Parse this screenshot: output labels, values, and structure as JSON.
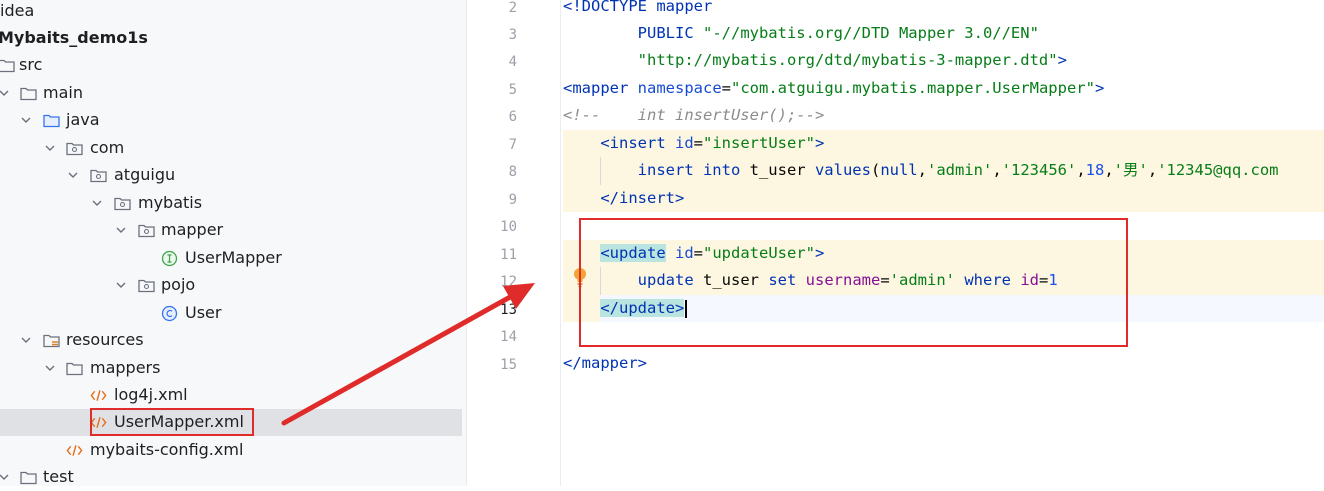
{
  "project_tree": {
    "items": [
      {
        "label": "idea",
        "icon": "folder-icon",
        "expanded": false
      },
      {
        "label": "Mybaits_demo1s",
        "icon": "module-icon",
        "expanded": true
      },
      {
        "label": "src",
        "icon": "folder-icon",
        "expanded": true
      },
      {
        "label": "main",
        "icon": "folder-icon",
        "expanded": true
      },
      {
        "label": "java",
        "icon": "source-folder-icon",
        "expanded": true
      },
      {
        "label": "com",
        "icon": "package-icon",
        "expanded": true
      },
      {
        "label": "atguigu",
        "icon": "package-icon",
        "expanded": true
      },
      {
        "label": "mybatis",
        "icon": "package-icon",
        "expanded": true
      },
      {
        "label": "mapper",
        "icon": "package-icon",
        "expanded": true
      },
      {
        "label": "UserMapper",
        "icon": "interface-icon"
      },
      {
        "label": "pojo",
        "icon": "package-icon",
        "expanded": true
      },
      {
        "label": "User",
        "icon": "class-icon"
      },
      {
        "label": "resources",
        "icon": "resources-folder-icon",
        "expanded": true
      },
      {
        "label": "mappers",
        "icon": "folder-icon",
        "expanded": true
      },
      {
        "label": "log4j.xml",
        "icon": "xml-file-icon"
      },
      {
        "label": "UserMapper.xml",
        "icon": "xml-file-icon",
        "selected": true
      },
      {
        "label": "mybaits-config.xml",
        "icon": "xml-file-icon"
      },
      {
        "label": "test",
        "icon": "folder-icon",
        "expanded": true
      }
    ]
  },
  "editor": {
    "line_numbers": [
      "2",
      "3",
      "4",
      "5",
      "6",
      "7",
      "8",
      "9",
      "10",
      "11",
      "12",
      "13",
      "14",
      "15"
    ],
    "current_line": "13",
    "lines": {
      "l2": {
        "open": "<!DOCTYPE",
        "name": " mapper"
      },
      "l3": {
        "indent": "        ",
        "kw": "PUBLIC",
        "val": " \"-//mybatis.org//DTD Mapper 3.0//EN\""
      },
      "l4": {
        "indent": "        ",
        "val": "\"http://mybatis.org/dtd/mybatis-3-mapper.dtd\"",
        "close": ">"
      },
      "l5": {
        "open": "<mapper",
        "attr": " namespace",
        "eq": "=",
        "val": "\"com.atguigu.mybatis.mapper.UserMapper\"",
        "close": ">"
      },
      "l6": {
        "comment": "<!--    int insertUser();-->"
      },
      "l7": {
        "indent": "    ",
        "open": "<insert",
        "attr": " id",
        "eq": "=",
        "val": "\"insertUser\"",
        "close": ">"
      },
      "l8": {
        "indent": "        ",
        "kw1": "insert into",
        "tbl": " t_user ",
        "kw2": "values",
        "p1": "(",
        "null": "null",
        "c1": ",",
        "s1": "'admin'",
        "c2": ",",
        "s2": "'123456'",
        "c3": ",",
        "n1": "18",
        "c4": ",",
        "s3": "'男'",
        "c5": ",",
        "s4": "'12345@qq.com"
      },
      "l9": {
        "indent": "    ",
        "close": "</insert>"
      },
      "l11": {
        "indent": "    ",
        "open_lt": "<",
        "open_name": "update",
        "attr": " id",
        "eq": "=",
        "val": "\"updateUser\"",
        "close": ">"
      },
      "l12": {
        "indent": "        ",
        "kw1": "update",
        "tbl": " t_user ",
        "kw2": "set",
        "sp": " ",
        "col": "username",
        "eq": "=",
        "s1": "'admin'",
        "sp2": " ",
        "kw3": "where",
        "sp3": " ",
        "col2": "id",
        "eq2": "=",
        "n1": "1"
      },
      "l13": {
        "indent": "    ",
        "close_lt": "</",
        "close_name": "update",
        "close_gt": ">"
      },
      "l15": {
        "close": "</mapper>"
      }
    }
  },
  "annotation": {
    "color": "#e02b2b",
    "arrow": "from-selected-file-to-update-block"
  }
}
